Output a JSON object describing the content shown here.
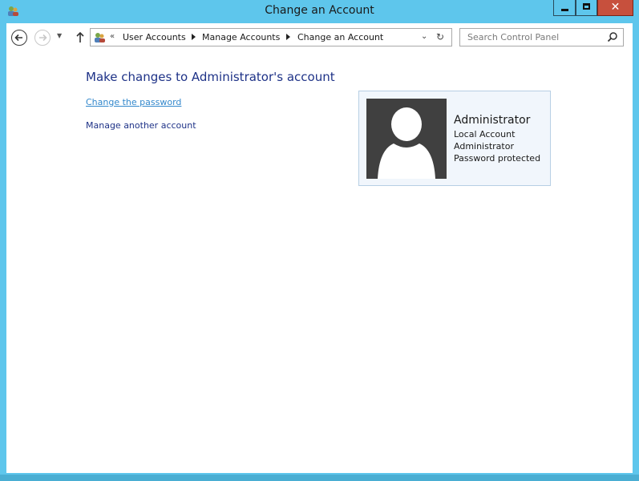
{
  "window": {
    "title": "Change an Account",
    "close_label": "✕"
  },
  "nav": {
    "breadcrumb_overflow": "«",
    "breadcrumbs": [
      "User Accounts",
      "Manage Accounts",
      "Change an Account"
    ],
    "search_placeholder": "Search Control Panel"
  },
  "content": {
    "heading": "Make changes to Administrator's account",
    "links": {
      "change_password": "Change the password",
      "manage_another": "Manage another account"
    }
  },
  "account": {
    "name": "Administrator",
    "type": "Local Account",
    "role": "Administrator",
    "password_status": "Password protected"
  },
  "colors": {
    "frame": "#5ec6ec",
    "link": "#1e3287",
    "close_button": "#c7503d"
  },
  "icons": [
    "user-accounts-icon",
    "back-arrow-icon",
    "forward-arrow-icon",
    "up-arrow-icon",
    "refresh-icon",
    "search-icon",
    "user-silhouette-icon"
  ]
}
